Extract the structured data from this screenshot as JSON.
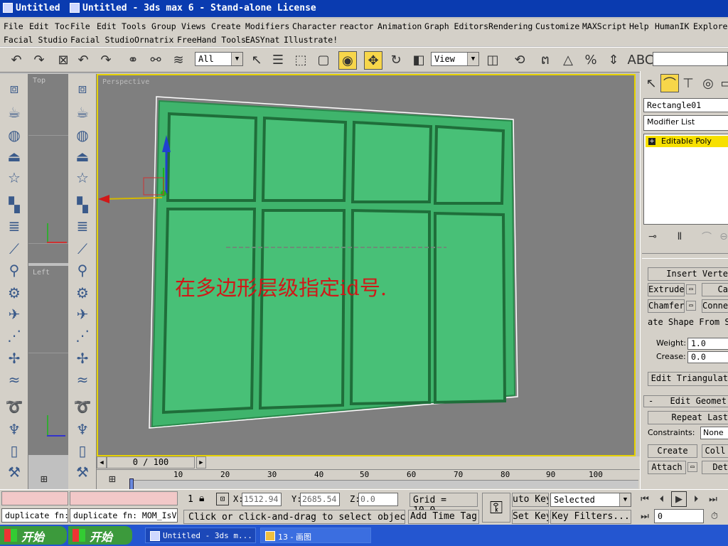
{
  "titles": {
    "left": "Untitled",
    "right": "Untitled - 3ds max 6 - Stand-alone License"
  },
  "menubar": {
    "row1": [
      "File",
      "Edit",
      "Toc",
      "File",
      "Edit",
      "Tools",
      "Group",
      "Views",
      "Create",
      "Modifiers",
      "Character",
      "reactor",
      "Animation",
      "Graph Editors",
      "Rendering",
      "Customize",
      "MAXScript",
      "Help",
      "HumanIK",
      "Explorer"
    ],
    "row2": [
      "Facial Studio",
      "Facial Studio",
      "Ornatrix",
      "FreeHand Tools",
      "EASYnat",
      "Illustrate!"
    ]
  },
  "toolbar": {
    "selection_filter": "All",
    "ref_coord": "View"
  },
  "viewports": {
    "top_label": "Top",
    "left_label": "Left",
    "perspective_label": "Perspective",
    "annotation": "在多边形层级指定id号."
  },
  "command_panel": {
    "object_name": "Rectangle01",
    "modifier_list": "Modifier List",
    "stack_item": "Editable Poly",
    "buttons": {
      "insert_vertex": "Insert Verte",
      "extrude": "Extrude",
      "ca": "Ca",
      "chamfer": "Chamfer",
      "connect": "Conne",
      "create_shape": "ate Shape From S",
      "edit_triangulation": "Edit Triangulat",
      "repeat_last": "Repeat Last",
      "create": "Create",
      "collapse": "Coll",
      "attach": "Attach",
      "detach": "Det"
    },
    "weight_label": "Weight:",
    "weight_value": "1.0",
    "crease_label": "Crease:",
    "crease_value": "0.0",
    "rollout_edit_geometry": "Edit Geometr",
    "constraints_label": "Constraints:",
    "constraints_value": "None"
  },
  "timeline": {
    "frame_display": "0 / 100",
    "ticks": [
      "10",
      "20",
      "30",
      "40",
      "50",
      "60",
      "70",
      "80",
      "90",
      "100"
    ]
  },
  "status": {
    "maxscript_left": "duplicate fn:",
    "maxscript_right": "duplicate fn: MOM_IsVa",
    "selected_count": "1",
    "x_label": "X:",
    "x_value": "1512.94",
    "y_label": "Y:",
    "y_value": "2685.54",
    "z_label": "Z:",
    "z_value": "0.0",
    "grid": "Grid = 10.0",
    "prompt": "Click or click-and-drag to select objects",
    "add_time_tag": "Add Time Tag",
    "auto_key": "uto Key",
    "set_key": "Set Key",
    "key_filter_value": "Selected",
    "key_filters": "Key Filters...",
    "frame_field": "0"
  },
  "taskbar": {
    "start1": "开始",
    "start2": "开始",
    "task1": "Untitled - 3ds m...",
    "task2": "13 - 画图"
  },
  "colors": {
    "title_blue": "#0a3bb0",
    "viewport_gray": "#7f7f7f",
    "object_green": "#3fb46c",
    "annotation_red": "#d01818",
    "active_yellow": "#f7d64a"
  }
}
